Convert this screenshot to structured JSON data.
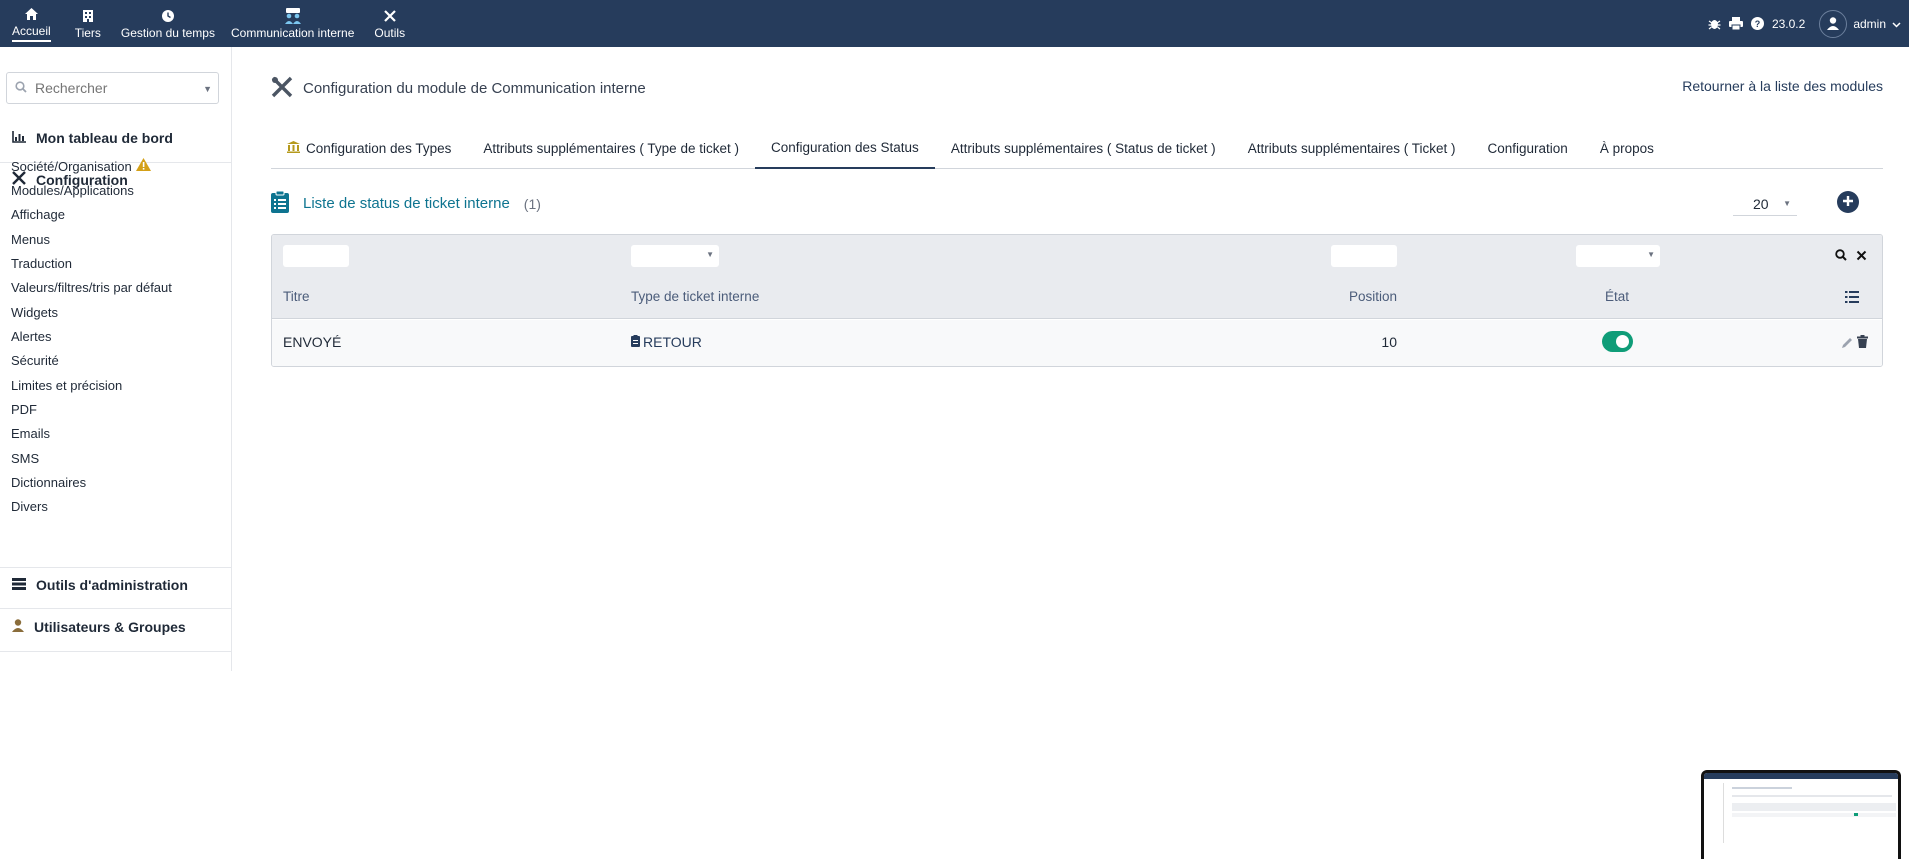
{
  "topnav": {
    "items": [
      {
        "label": "Accueil",
        "icon": "home-icon"
      },
      {
        "label": "Tiers",
        "icon": "building-icon"
      },
      {
        "label": "Gestion du temps",
        "icon": "clock-icon"
      },
      {
        "label": "Communication interne",
        "icon": "users-icon"
      },
      {
        "label": "Outils",
        "icon": "tools-icon"
      }
    ],
    "version": "23.0.2",
    "user": "admin"
  },
  "sidebar": {
    "search_placeholder": "Rechercher",
    "dashboard": "Mon tableau de bord",
    "configuration": "Configuration",
    "config_items": [
      "Société/Organisation",
      "Modules/Applications",
      "Affichage",
      "Menus",
      "Traduction",
      "Valeurs/filtres/tris par défaut",
      "Widgets",
      "Alertes",
      "Sécurité",
      "Limites et précision",
      "PDF",
      "Emails",
      "SMS",
      "Dictionnaires",
      "Divers"
    ],
    "admin_tools": "Outils d'administration",
    "users_groups": "Utilisateurs & Groupes"
  },
  "header": {
    "title": "Configuration du module de Communication interne",
    "back_link": "Retourner à la liste des modules"
  },
  "tabs": [
    {
      "label": "Configuration des Types",
      "active": false
    },
    {
      "label": "Attributs supplémentaires ( Type de ticket )",
      "active": false
    },
    {
      "label": "Configuration des Status",
      "active": true
    },
    {
      "label": "Attributs supplémentaires ( Status de ticket )",
      "active": false
    },
    {
      "label": "Attributs supplémentaires ( Ticket )",
      "active": false
    },
    {
      "label": "Configuration",
      "active": false
    },
    {
      "label": "À propos",
      "active": false
    }
  ],
  "list": {
    "title": "Liste de status de ticket interne",
    "count": "(1)",
    "limit": "20",
    "columns": {
      "title": "Titre",
      "type": "Type de ticket interne",
      "position": "Position",
      "state": "État"
    },
    "rows": [
      {
        "title": "ENVOYÉ",
        "type": "RETOUR",
        "position": "10",
        "state_on": true
      }
    ]
  },
  "colors": {
    "nav": "#263c5c",
    "accent": "#0e7490",
    "toggle_on": "#0f9d78",
    "warning": "#d4a017"
  }
}
